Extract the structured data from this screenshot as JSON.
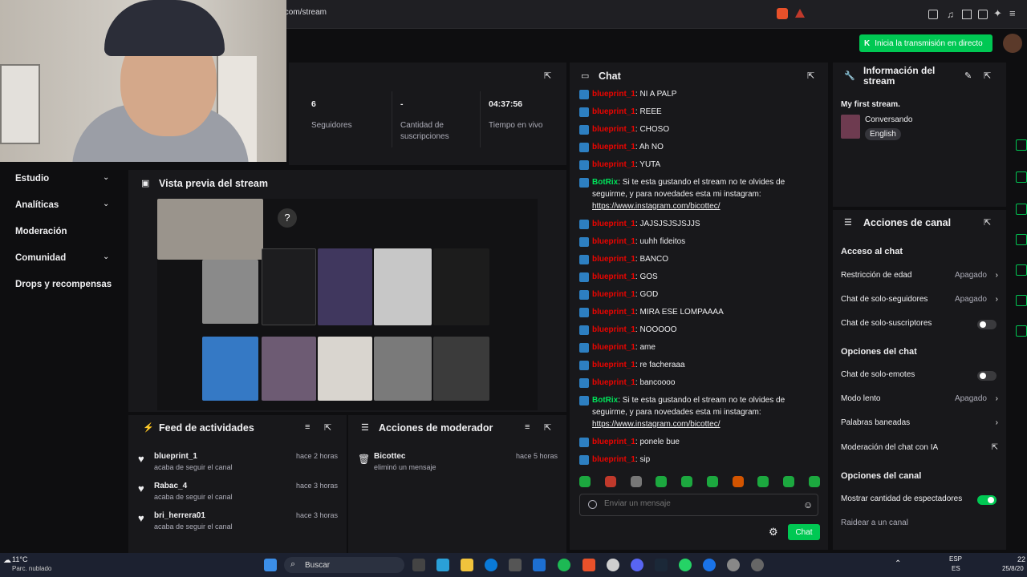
{
  "browser": {
    "url": ".com/stream"
  },
  "top": {
    "go_live": "Inicia la transmisión en directo"
  },
  "sidebar": {
    "items": [
      {
        "label": "Estudio",
        "chev": true
      },
      {
        "label": "Analíticas",
        "chev": true
      },
      {
        "label": "Moderación",
        "chev": false
      },
      {
        "label": "Comunidad",
        "chev": true
      },
      {
        "label": "Drops y recompensas",
        "chev": false
      }
    ]
  },
  "stats": [
    {
      "value": "6",
      "label": "Seguidores"
    },
    {
      "value": "-",
      "label": "Cantidad de suscripciones"
    },
    {
      "value": "04:37:56",
      "label": "Tiempo en vivo"
    }
  ],
  "preview": {
    "title": "Vista previa del stream"
  },
  "feed": {
    "title": "Feed de actividades",
    "items": [
      {
        "name": "blueprint_1",
        "sub": "acaba de seguir el canal",
        "time": "hace 2 horas"
      },
      {
        "name": "Rabac_4",
        "sub": "acaba de seguir el canal",
        "time": "hace 3 horas"
      },
      {
        "name": "bri_herrera01",
        "sub": "acaba de seguir el canal",
        "time": "hace 3 horas"
      }
    ]
  },
  "modactions": {
    "title": "Acciones de moderador",
    "items": [
      {
        "name": "Bicottec",
        "sub": "eliminó un mensaje",
        "time": "hace 5 horas"
      }
    ]
  },
  "chat": {
    "title": "Chat",
    "placeholder": "Enviar un mensaje",
    "send": "Chat",
    "messages": [
      {
        "user": "blueprint_1",
        "text": ": NI A PALP"
      },
      {
        "user": "blueprint_1",
        "text": ": REEE"
      },
      {
        "user": "blueprint_1",
        "text": ": CHOSO"
      },
      {
        "user": "blueprint_1",
        "text": ": Ah NO"
      },
      {
        "user": "blueprint_1",
        "text": ": YUTA"
      },
      {
        "user": "BotRix",
        "bot": true,
        "text": ": Si te esta gustando el stream no te olvides de seguirme, y para novedades esta mi instagram:",
        "link": "https://www.instagram.com/bicottec/"
      },
      {
        "user": "blueprint_1",
        "text": ": JAJSJSJSJSJJS"
      },
      {
        "user": "blueprint_1",
        "text": ": uuhh fideitos"
      },
      {
        "user": "blueprint_1",
        "text": ": BANCO"
      },
      {
        "user": "blueprint_1",
        "text": ": GOS"
      },
      {
        "user": "blueprint_1",
        "text": ": GOD"
      },
      {
        "user": "blueprint_1",
        "text": ": MIRA ESE LOMPAAAA"
      },
      {
        "user": "blueprint_1",
        "text": ": NOOOOO"
      },
      {
        "user": "blueprint_1",
        "text": ": ame"
      },
      {
        "user": "blueprint_1",
        "text": ": re facheraaa"
      },
      {
        "user": "blueprint_1",
        "text": ": bancoooo"
      },
      {
        "user": "BotRix",
        "bot": true,
        "text": ": Si te esta gustando el stream no te olvides de seguirme, y para novedades esta mi instagram:",
        "link": "https://www.instagram.com/bicottec/"
      },
      {
        "user": "blueprint_1",
        "text": ": ponele bue"
      },
      {
        "user": "blueprint_1",
        "text": ": sip"
      }
    ]
  },
  "info": {
    "title": "Información del stream",
    "stream_title": "My first stream.",
    "category": "Conversando",
    "tag": "English"
  },
  "actions": {
    "title": "Acciones de canal",
    "chat_access": "Acceso al chat",
    "age": "Restricción de edad",
    "age_val": "Apagado",
    "followers": "Chat de solo-seguidores",
    "followers_val": "Apagado",
    "subs": "Chat de solo-suscriptores",
    "chat_options": "Opciones del chat",
    "emotes": "Chat de solo-emotes",
    "slow": "Modo lento",
    "slow_val": "Apagado",
    "banned": "Palabras baneadas",
    "ai": "Moderación del chat con IA",
    "channel_options": "Opciones del canal",
    "viewers": "Mostrar cantidad de espectadores",
    "raid": "Raidear a un canal"
  },
  "taskbar": {
    "weather": "11°C",
    "weather_sub": "Parc. nublado",
    "search": "Buscar",
    "lang": "ESP",
    "lang2": "ES",
    "time": "22",
    "date": "25/8/20"
  }
}
